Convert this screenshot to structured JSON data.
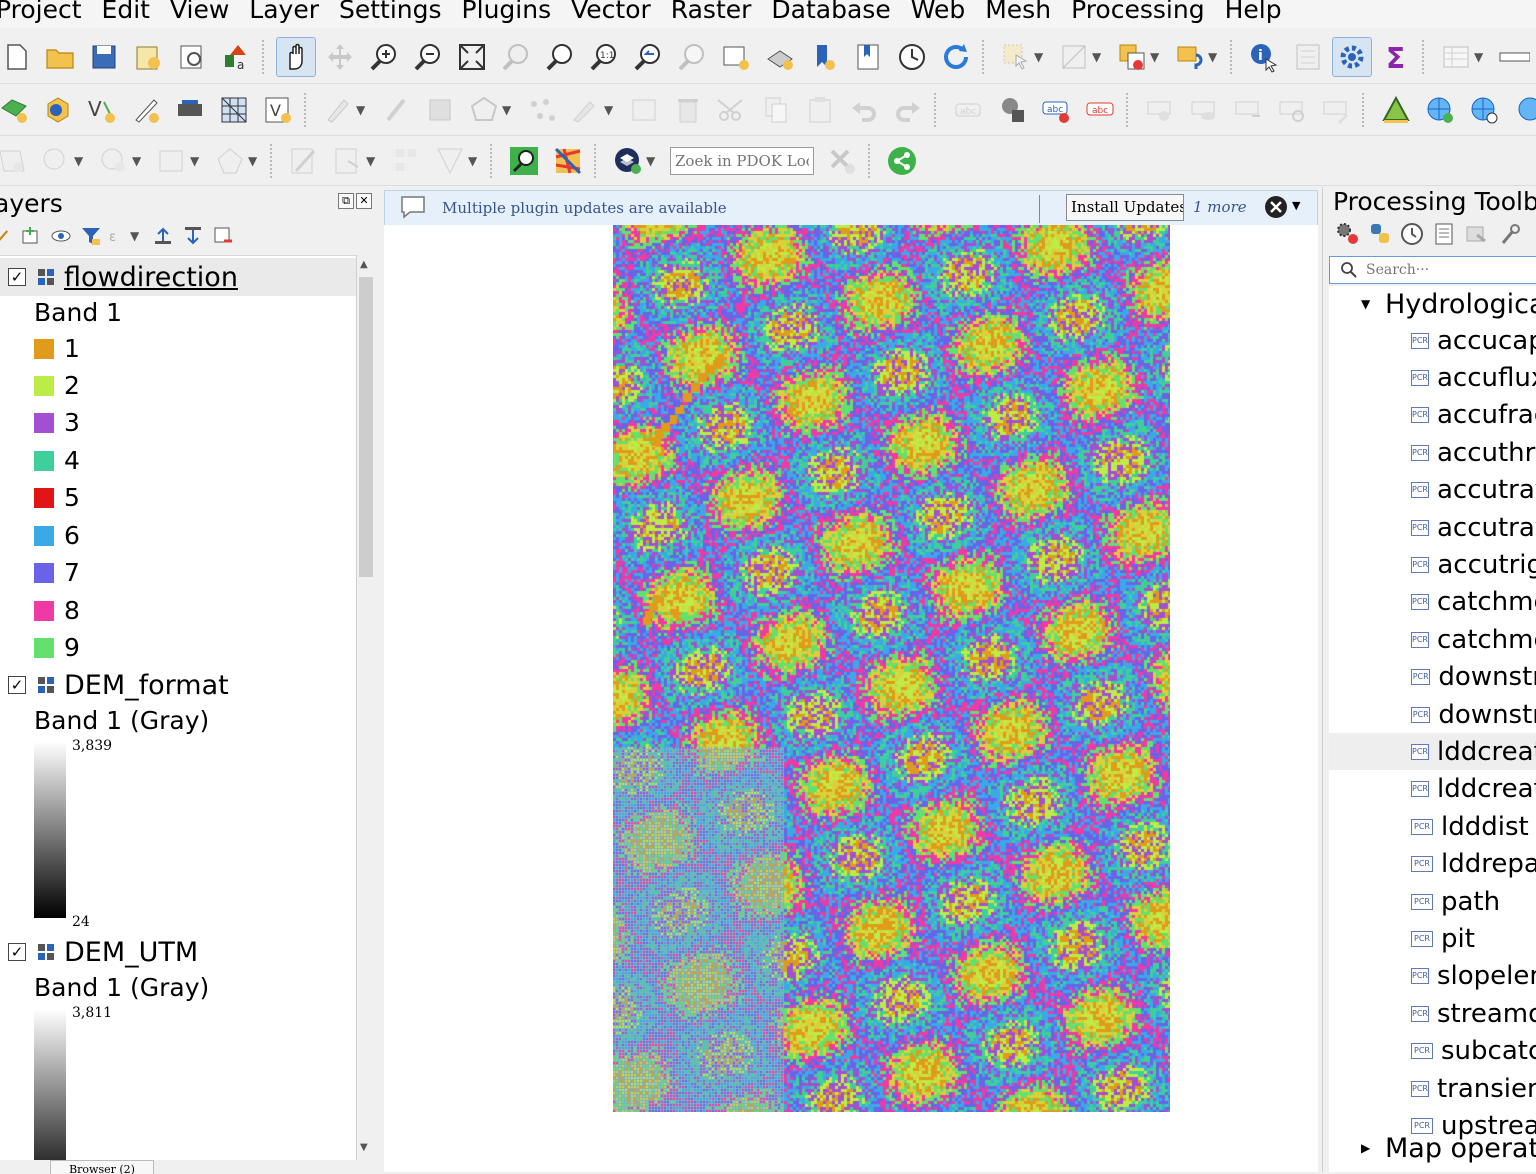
{
  "menubar": {
    "items": [
      "Project",
      "Edit",
      "View",
      "Layer",
      "Settings",
      "Plugins",
      "Vector",
      "Raster",
      "Database",
      "Web",
      "Mesh",
      "Processing",
      "Help"
    ]
  },
  "toolbar3": {
    "pdok_placeholder": "Zoek in PDOK Loc···"
  },
  "layers_panel": {
    "title": "ayers",
    "layers": [
      {
        "name": "flowdirection",
        "checked": true,
        "band": "Band 1",
        "legend": [
          {
            "value": "1",
            "color": "#e09b1a"
          },
          {
            "value": "2",
            "color": "#bcec45"
          },
          {
            "value": "3",
            "color": "#a24fd1"
          },
          {
            "value": "4",
            "color": "#3fcf9a"
          },
          {
            "value": "5",
            "color": "#e01616"
          },
          {
            "value": "6",
            "color": "#3aa9e6"
          },
          {
            "value": "7",
            "color": "#6a63e8"
          },
          {
            "value": "8",
            "color": "#ef3aa5"
          },
          {
            "value": "9",
            "color": "#63e06d"
          }
        ]
      },
      {
        "name": "DEM_format",
        "checked": true,
        "band": "Band 1 (Gray)",
        "max": "3,839",
        "min": "24"
      },
      {
        "name": "DEM_UTM",
        "checked": true,
        "band": "Band 1 (Gray)",
        "max": "3,811"
      }
    ],
    "bottom_tab": "Browser (2)"
  },
  "message_bar": {
    "text": "Multiple plugin updates are available",
    "install_button": "Install Updates···",
    "more": "1 more"
  },
  "processing": {
    "title": "Processing Toolb",
    "search_placeholder": "Search···",
    "group": "Hydrologica",
    "algorithms": [
      "accucap",
      "accuflux",
      "accufrac",
      "accuthre",
      "accutrav",
      "accutrav",
      "accutrig",
      "catchme",
      "catchme",
      "downstr",
      "downstr",
      "lddcreat",
      "lddcreat",
      "ldddist",
      "lddrepa",
      "path",
      "pit",
      "slopelen",
      "streamo",
      "subcatc",
      "transien",
      "upstrea"
    ],
    "next_group": "Map operati",
    "icon_label": "PCR"
  },
  "map": {
    "palette": [
      "#e09b1a",
      "#bcec45",
      "#a24fd1",
      "#3fcf9a",
      "#3aa9e6",
      "#6a63e8",
      "#ef3aa5",
      "#63e06d",
      "#d9d13a"
    ]
  }
}
